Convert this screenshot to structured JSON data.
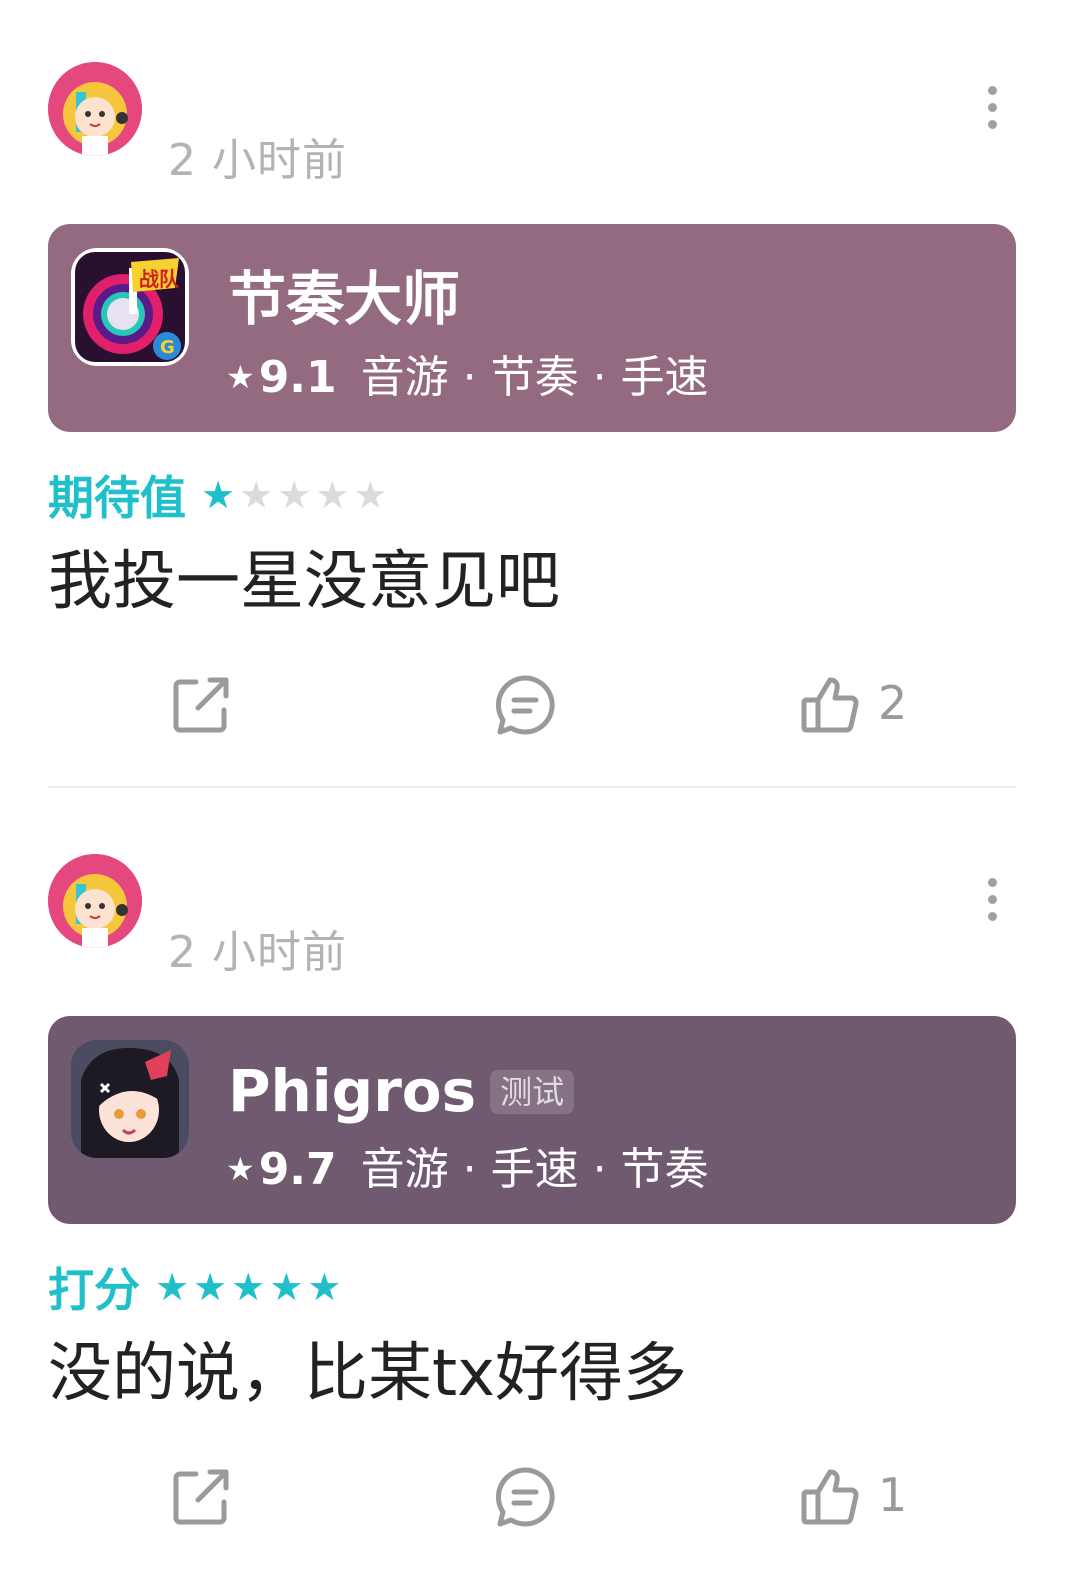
{
  "posts": [
    {
      "time": "2 小时前",
      "app": {
        "name": "节奏大师",
        "badge": "",
        "icon": "rhythm-master-app-icon",
        "star": "★",
        "score": "9.1",
        "tags": "音游 · 节奏 · 手速",
        "card_color": "#946a80"
      },
      "rating_label": "期待值",
      "rating_stars": 1,
      "rating_max": 5,
      "review": "我投一星没意见吧",
      "likes": "2"
    },
    {
      "time": "2 小时前",
      "app": {
        "name": "Phigros",
        "badge": "测试",
        "icon": "phigros-app-icon",
        "star": "★",
        "score": "9.7",
        "tags": "音游 · 手速 · 节奏",
        "card_color": "#705a70"
      },
      "rating_label": "打分",
      "rating_stars": 5,
      "rating_max": 5,
      "review": "没的说，比某tx好得多",
      "likes": "1"
    }
  ],
  "colors": {
    "accent": "#1fc0c9",
    "star_off": "#d9dcdf",
    "muted_text": "#b3b3b3",
    "icon_gray": "#9a9a9a"
  }
}
